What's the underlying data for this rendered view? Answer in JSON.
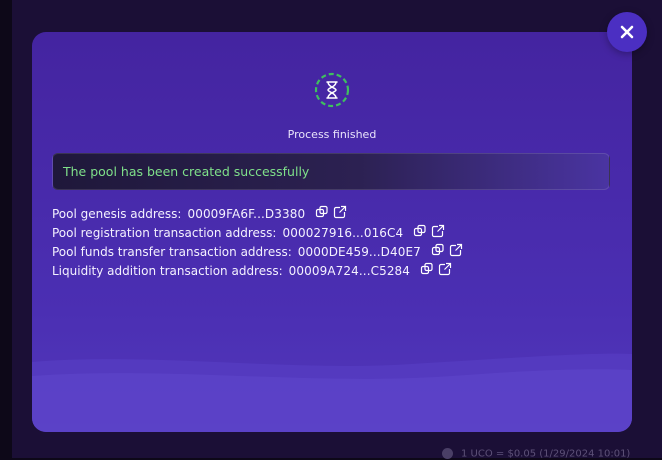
{
  "modal": {
    "status_title": "Process finished",
    "success_message": "The pool has been created successfully",
    "addresses": [
      {
        "label": "Pool genesis address:",
        "value": "00009FA6F...D3380"
      },
      {
        "label": "Pool registration transaction address:",
        "value": "000027916...016C4"
      },
      {
        "label": "Pool funds transfer transaction address:",
        "value": "0000DE459...D40E7"
      },
      {
        "label": "Liquidity addition transaction address:",
        "value": "00009A724...C5284"
      }
    ],
    "icons": {
      "close": "close-icon",
      "status": "hourglass-icon",
      "copy": "copy-icon",
      "open": "external-link-icon"
    }
  },
  "backdrop": {
    "footer_text": "1 UCO = $0.05 (1/29/2024 10:01)"
  },
  "colors": {
    "modal_bg": "#4b2fb3",
    "success_text": "#7fe08a",
    "status_ring": "#3fbf5f"
  }
}
